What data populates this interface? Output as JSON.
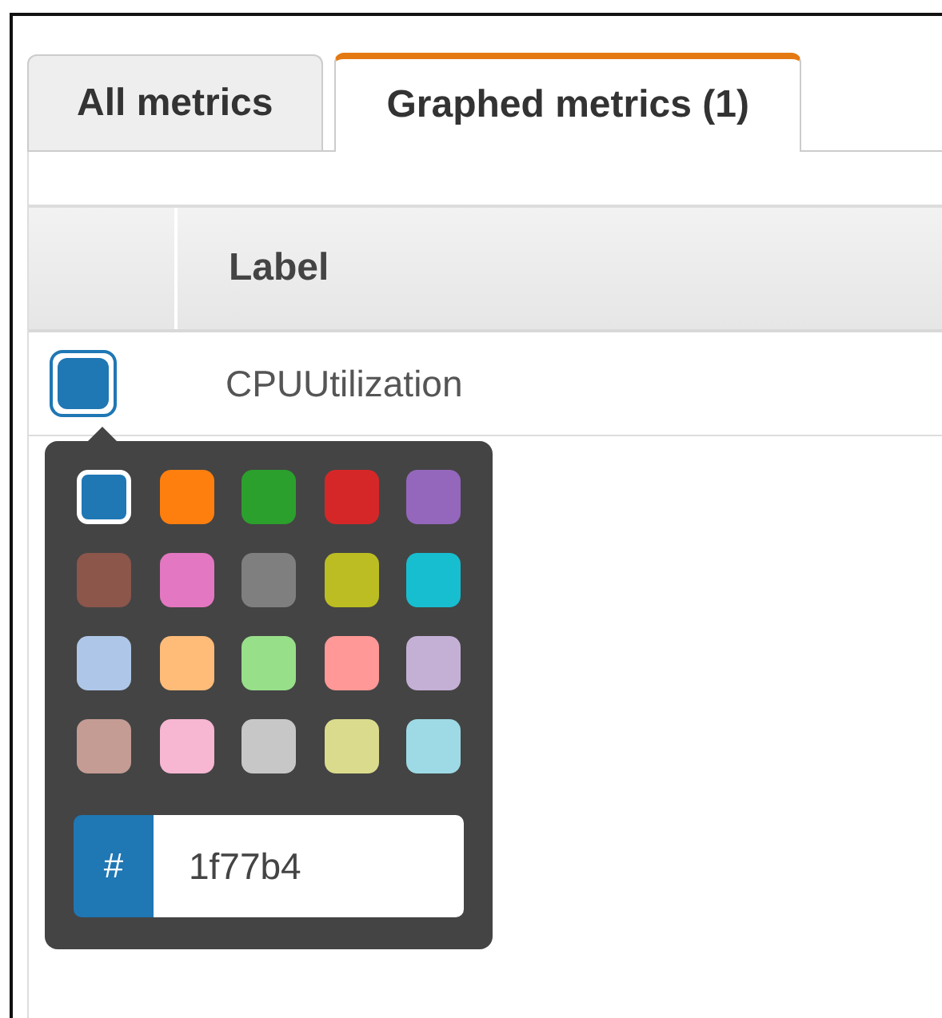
{
  "tabs": [
    {
      "label": "All metrics",
      "selected": false
    },
    {
      "label": "Graphed metrics (1)",
      "selected": true
    }
  ],
  "table": {
    "columns": [
      "Label"
    ],
    "rows": [
      {
        "label": "CPUUtilization",
        "color": "#1f77b4"
      }
    ]
  },
  "color_picker": {
    "swatches": [
      {
        "color": "#1f77b4",
        "selected": true
      },
      {
        "color": "#ff7f0e",
        "selected": false
      },
      {
        "color": "#2ca02c",
        "selected": false
      },
      {
        "color": "#d62728",
        "selected": false
      },
      {
        "color": "#9467bd",
        "selected": false
      },
      {
        "color": "#8c564b",
        "selected": false
      },
      {
        "color": "#e377c2",
        "selected": false
      },
      {
        "color": "#7f7f7f",
        "selected": false
      },
      {
        "color": "#bcbd22",
        "selected": false
      },
      {
        "color": "#17becf",
        "selected": false
      },
      {
        "color": "#aec7e8",
        "selected": false
      },
      {
        "color": "#ffbb78",
        "selected": false
      },
      {
        "color": "#98df8a",
        "selected": false
      },
      {
        "color": "#ff9896",
        "selected": false
      },
      {
        "color": "#c5b0d5",
        "selected": false
      },
      {
        "color": "#c49c94",
        "selected": false
      },
      {
        "color": "#f7b6d2",
        "selected": false
      },
      {
        "color": "#c7c7c7",
        "selected": false
      },
      {
        "color": "#dbdb8d",
        "selected": false
      },
      {
        "color": "#9edae5",
        "selected": false
      }
    ],
    "hash_label": "#",
    "hex_value": "1f77b4"
  }
}
